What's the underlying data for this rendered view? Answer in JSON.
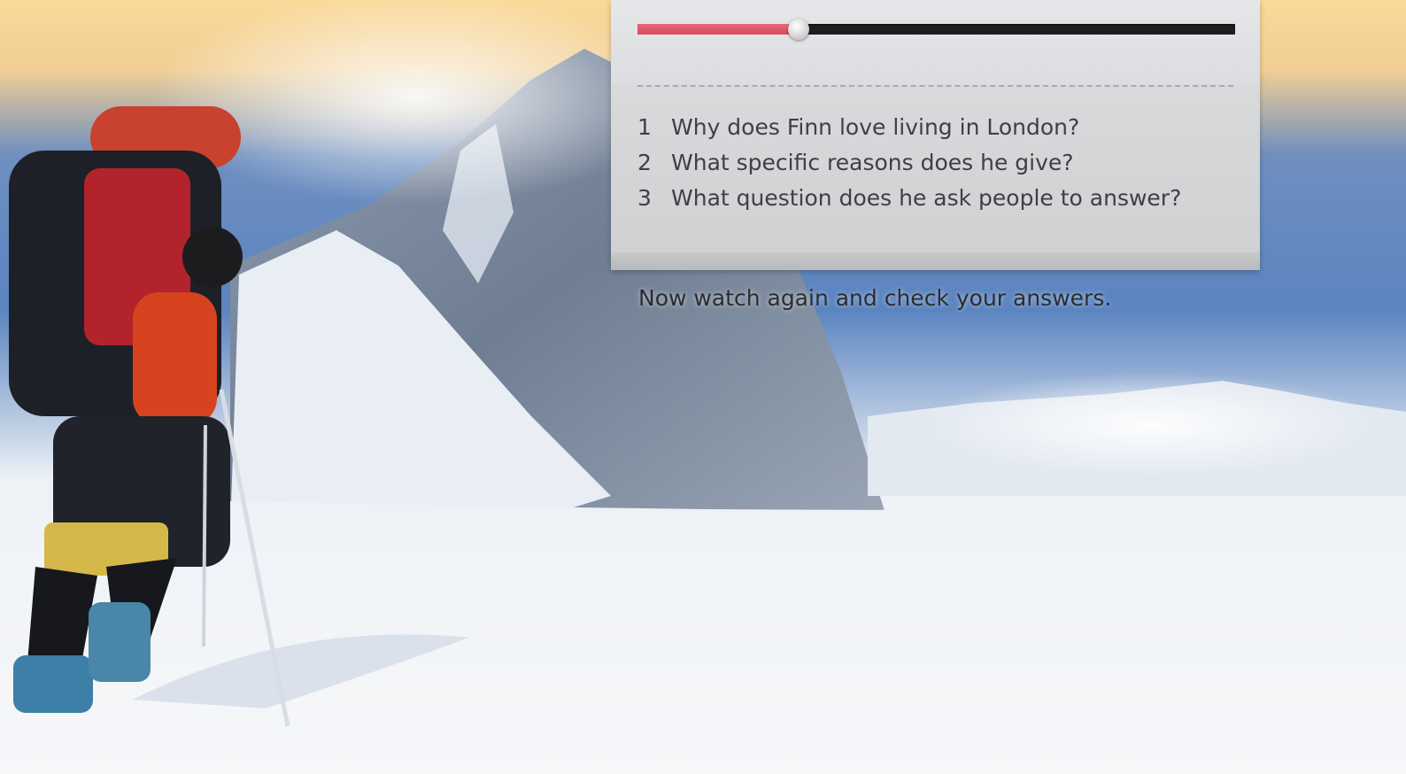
{
  "player": {
    "progress": 0.27
  },
  "questions": [
    {
      "number": "1",
      "text": "Why does Finn love living in London?"
    },
    {
      "number": "2",
      "text": "What specific reasons does he give?"
    },
    {
      "number": "3",
      "text": "What question does he ask people to answer?"
    }
  ],
  "instruction": "Now watch again and check your answers.",
  "colors": {
    "progress_fill": "#e05563",
    "track": "#1f1f21",
    "panel": "#d9dadc",
    "sky_top": "#fad89a",
    "sky_blue": "#4f78b5"
  },
  "icons": {
    "slider_thumb": "circle-knob-icon"
  }
}
